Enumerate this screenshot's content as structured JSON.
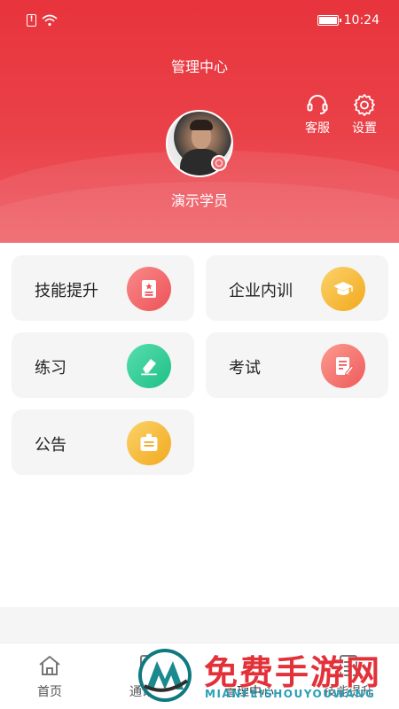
{
  "status_bar": {
    "time": "10:24",
    "icons": [
      "sim-alert-icon",
      "wifi-icon",
      "battery-icon"
    ]
  },
  "header": {
    "title": "管理中心",
    "actions": [
      {
        "label": "客服",
        "icon": "headset-icon"
      },
      {
        "label": "设置",
        "icon": "gear-icon"
      }
    ],
    "username": "演示学员"
  },
  "menu": {
    "items": [
      {
        "label": "技能提升",
        "icon": "badge-icon",
        "color": "#ee5257"
      },
      {
        "label": "企业内训",
        "icon": "graduation-cap-icon",
        "color": "#f2a91c"
      },
      {
        "label": "练习",
        "icon": "eraser-icon",
        "color": "#1fbf86"
      },
      {
        "label": "考试",
        "icon": "edit-doc-icon",
        "color": "#ef5a5c"
      },
      {
        "label": "公告",
        "icon": "notice-board-icon",
        "color": "#f2a91c"
      }
    ]
  },
  "bottom_nav": {
    "items": [
      {
        "label": "首页",
        "icon": "home-icon"
      },
      {
        "label": "通讯录",
        "icon": "contacts-icon"
      },
      {
        "label": "管理中心",
        "icon": "manage-icon",
        "active": true
      },
      {
        "label": "技能提升",
        "icon": "skill-icon"
      }
    ]
  },
  "watermark": {
    "title": "免费手游网",
    "subtitle": "MIANFEISHOUYOUWANG"
  },
  "colors": {
    "header_red": "#e8343c",
    "card_bg": "#f5f5f5",
    "watermark_red": "#e3313a"
  }
}
